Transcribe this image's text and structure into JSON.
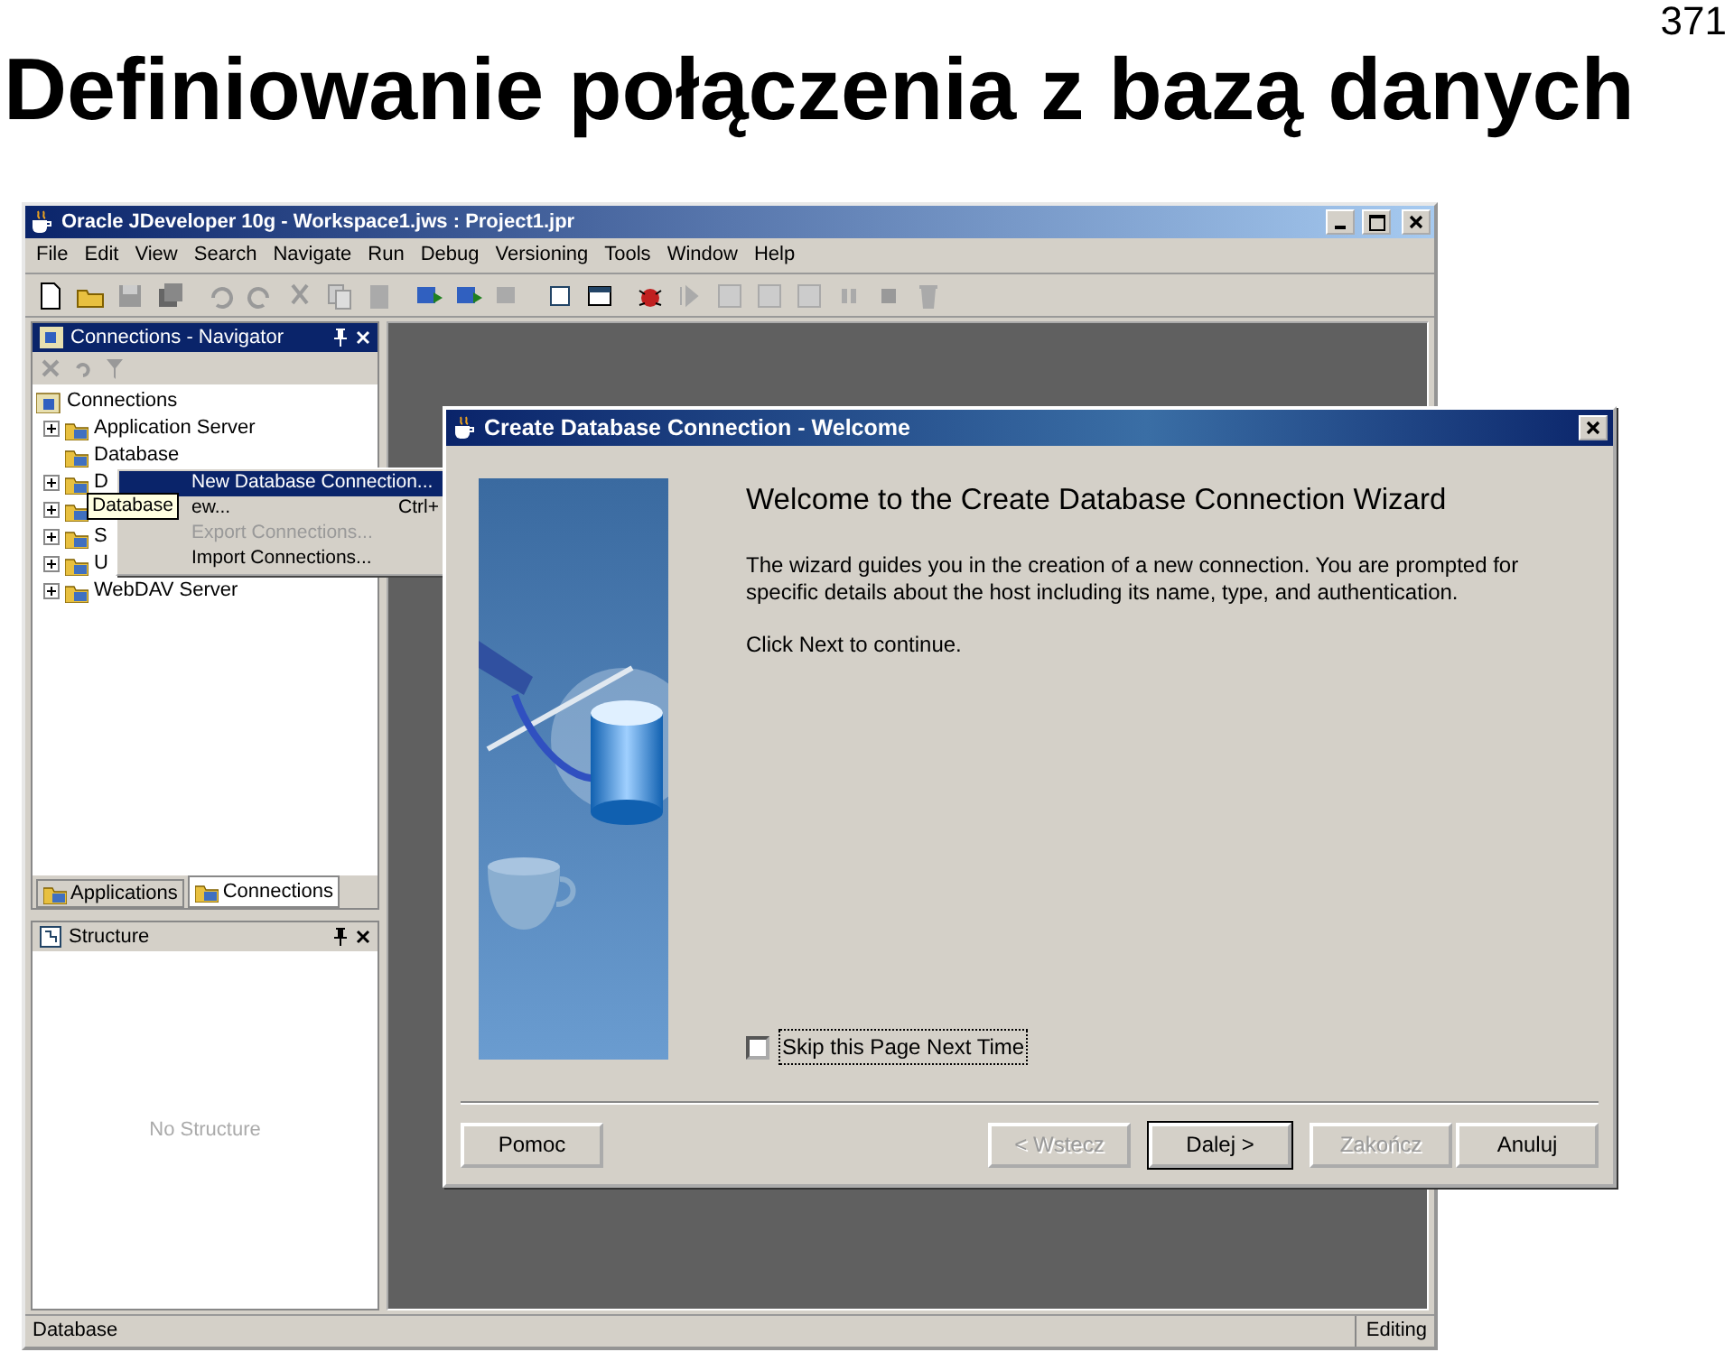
{
  "slide": {
    "title": "Definiowanie połączenia z bazą danych",
    "page_number": "371"
  },
  "window": {
    "title": "Oracle JDeveloper 10g - Workspace1.jws : Project1.jpr"
  },
  "menu_bar": [
    "File",
    "Edit",
    "View",
    "Search",
    "Navigate",
    "Run",
    "Debug",
    "Versioning",
    "Tools",
    "Window",
    "Help"
  ],
  "navigator": {
    "title": "Connections - Navigator",
    "tree": {
      "label": "Connections",
      "children": [
        {
          "label": "Application Server",
          "collapsed": true
        },
        {
          "label": "Database",
          "collapsed": false
        },
        {
          "label": "D",
          "collapsed": true
        },
        {
          "collapsed": true
        },
        {
          "label": "S",
          "collapsed": true
        },
        {
          "label": "U",
          "collapsed": true
        },
        {
          "label": "WebDAV Server",
          "collapsed": true
        }
      ]
    },
    "tabs": [
      {
        "label": "Applications",
        "selected": false
      },
      {
        "label": "Connections",
        "selected": true
      }
    ]
  },
  "structure": {
    "title": "Structure",
    "empty_text": "No Structure"
  },
  "context_menu": [
    {
      "label": "New Database Connection...",
      "selected": true,
      "disabled": false
    },
    {
      "label": "ew...",
      "shortcut": "Ctrl+",
      "selected": false,
      "disabled": false
    },
    {
      "label": "Export Connections...",
      "selected": false,
      "disabled": true
    },
    {
      "label": "Import Connections...",
      "selected": false,
      "disabled": false
    }
  ],
  "tooltip": "Database",
  "dialog": {
    "title": "Create Database Connection - Welcome",
    "heading": "Welcome to the Create Database Connection Wizard",
    "paragraphs": [
      "The wizard guides you in the creation of a new connection. You are prompted for specific details about the host including its name, type, and authentication.",
      "Click Next to continue."
    ],
    "checkbox": {
      "label": "Skip this Page Next Time",
      "checked": false
    },
    "buttons": [
      {
        "label": "Pomoc",
        "disabled": false,
        "default": false
      },
      {
        "label": "< Wstecz",
        "disabled": true,
        "default": false
      },
      {
        "label": "Dalej >",
        "disabled": false,
        "default": true
      },
      {
        "label": "Zakończ",
        "disabled": true,
        "default": false
      },
      {
        "label": "Anuluj",
        "disabled": false,
        "default": false
      }
    ]
  },
  "status_bar": {
    "left": "Database",
    "right": "Editing"
  }
}
